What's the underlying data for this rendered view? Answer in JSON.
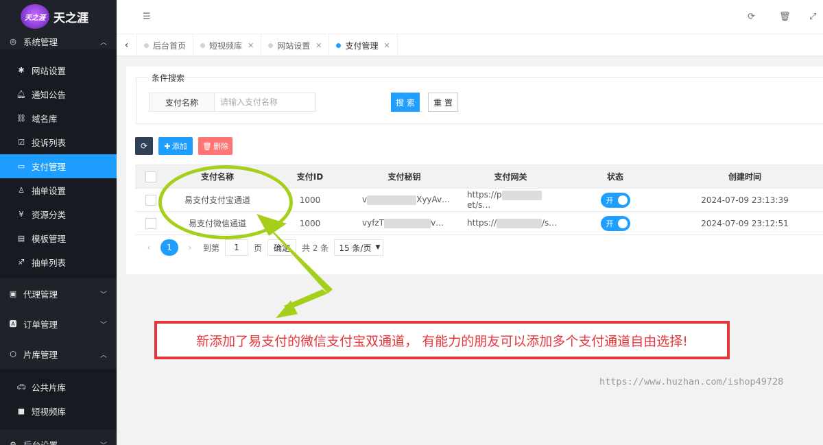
{
  "brand": {
    "logo_text": "天之涯",
    "badge_text": "天之涯"
  },
  "sidebar": {
    "groups": [
      {
        "label": "系统管理",
        "icon": "target-icon",
        "chevron": "up"
      },
      {
        "label": "代理管理",
        "icon": "contact-book-icon",
        "chevron": "down"
      },
      {
        "label": "订单管理",
        "icon": "letter-a-icon",
        "chevron": "down"
      },
      {
        "label": "片库管理",
        "icon": "hexagon-icon",
        "chevron": "up"
      },
      {
        "label": "后台设置",
        "icon": "gears-icon",
        "chevron": "down"
      }
    ],
    "system_items": [
      {
        "label": "网站设置",
        "icon": "asterisk-icon"
      },
      {
        "label": "通知公告",
        "icon": "bell-icon"
      },
      {
        "label": "域名库",
        "icon": "link-icon"
      },
      {
        "label": "投诉列表",
        "icon": "check-square-icon"
      },
      {
        "label": "支付管理",
        "icon": "wave-card-icon",
        "active": true
      },
      {
        "label": "抽单设置",
        "icon": "people-icon"
      },
      {
        "label": "资源分类",
        "icon": "yen-icon"
      },
      {
        "label": "模板管理",
        "icon": "template-icon"
      },
      {
        "label": "抽单列表",
        "icon": "runner-icon"
      }
    ],
    "library_items": [
      {
        "label": "公共片库",
        "icon": "car-icon"
      },
      {
        "label": "短视频库",
        "icon": "video-icon"
      }
    ]
  },
  "tabs": [
    {
      "label": "后台首页"
    },
    {
      "label": "短视频库"
    },
    {
      "label": "网站设置"
    },
    {
      "label": "支付管理",
      "active": true
    }
  ],
  "search": {
    "legend": "条件搜索",
    "field_label": "支付名称",
    "placeholder": "请输入支付名称",
    "search_button": "搜 索",
    "reset_button": "重 置"
  },
  "toolbar": {
    "add_label": "添加",
    "delete_label": "删除"
  },
  "table": {
    "columns": [
      "支付名称",
      "支付ID",
      "支付秘钥",
      "支付网关",
      "状态",
      "创建时间"
    ],
    "rows": [
      {
        "name": "易支付支付宝通道",
        "id": "1000",
        "key_prefix": "v",
        "key_suffix": "XyyAv…",
        "gateway_prefix": "https://p",
        "gateway_suffix": "et/s…",
        "status": "开",
        "created": "2024-07-09 23:13:39"
      },
      {
        "name": "易支付微信通道",
        "id": "1000",
        "key_prefix": "vyfzT",
        "key_suffix": "v…",
        "gateway_prefix": "https://",
        "gateway_suffix": "/s…",
        "status": "开",
        "created": "2024-07-09 23:12:51"
      }
    ]
  },
  "pagination": {
    "current": "1",
    "goto_label": "到第",
    "goto_value": "1",
    "page_unit": "页",
    "confirm": "确定",
    "total": "共 2 条",
    "page_size": "15 条/页"
  },
  "annotation": {
    "banner_text": "新添加了易支付的微信支付宝双通道， 有能力的朋友可以添加多个支付通道自由选择!",
    "watermark": "https://www.huzhan.com/ishop49728"
  },
  "colors": {
    "accent": "#1e9fff",
    "sidebar_bg": "#20222a",
    "annotation_red": "#e8353b",
    "annotation_green": "#a6cf1b"
  }
}
